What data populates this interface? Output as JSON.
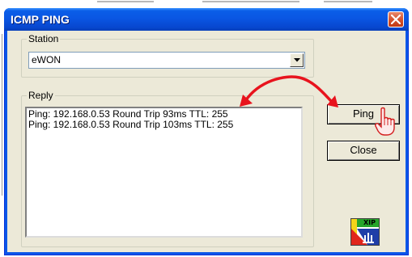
{
  "dialog": {
    "title": "ICMP PING"
  },
  "station": {
    "label": "Station",
    "selected": "eWON"
  },
  "reply": {
    "label": "Reply",
    "lines": [
      "Ping: 192.168.0.53 Round Trip 93ms TTL: 255",
      "Ping: 192.168.0.53 Round Trip 103ms TTL: 255"
    ]
  },
  "buttons": {
    "ping_label": "Ping",
    "close_label": "Close"
  },
  "logo": {
    "text": "XIP"
  },
  "icons": {
    "close": "close-icon",
    "dropdown": "chevron-down-icon",
    "hand": "hand-pointer-icon",
    "annotation": "curved-arrow-icon"
  },
  "colors": {
    "titlebar": "#0a56e8",
    "close_button": "#d6532e",
    "dialog_bg": "#ece9d8",
    "annotation_arrow": "#e8131d"
  }
}
